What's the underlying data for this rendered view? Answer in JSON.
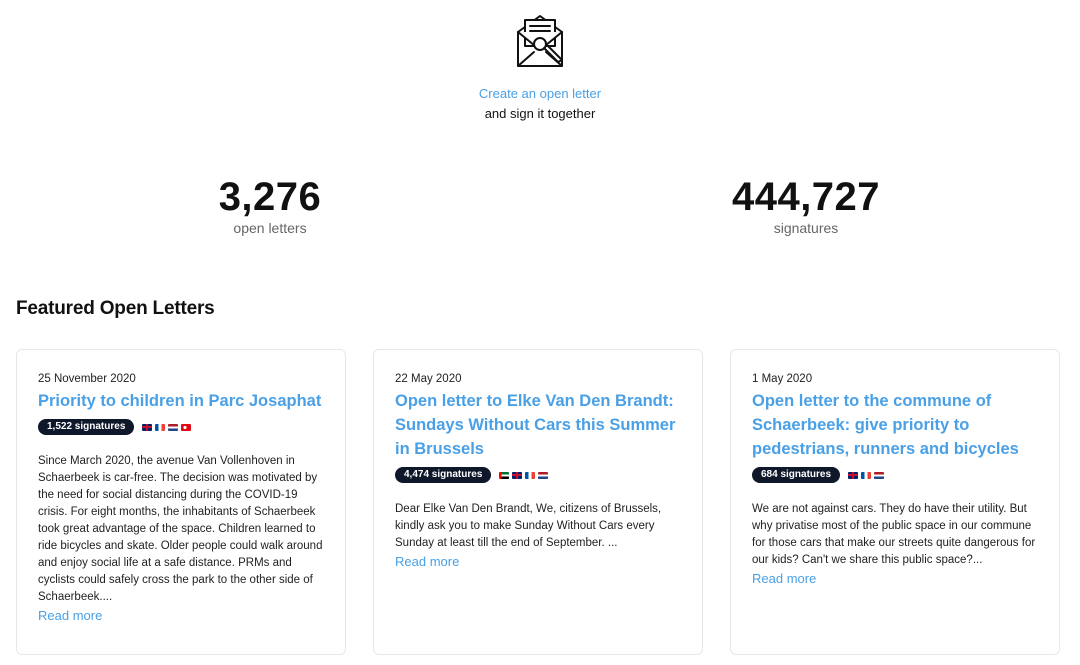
{
  "hero": {
    "icon": "envelope-letter-icon",
    "create_link": "Create an open letter",
    "subtitle": "and sign it together"
  },
  "stats": {
    "letters": {
      "value": "3,276",
      "label": "open letters"
    },
    "signatures": {
      "value": "444,727",
      "label": "signatures"
    }
  },
  "featured": {
    "heading": "Featured Open Letters",
    "cards": [
      {
        "date": "25 November 2020",
        "title": "Priority to children in Parc Josaphat",
        "signatures": "1,522 signatures",
        "languages": [
          "en",
          "fr",
          "nl",
          "tr"
        ],
        "excerpt": "Since March 2020, the avenue Van Vollenhoven in Schaerbeek is car-free. The decision was motivated by the need for social distancing during the COVID-19 crisis. For eight months, the inhabitants of Schaerbeek took great advantage of the space. Children learned to ride bicycles and skate. Older people could walk around and enjoy social life at a safe distance. PRMs and cyclists could safely cross the park to the other side of Schaerbeek....",
        "read_more": "Read more"
      },
      {
        "date": "22 May 2020",
        "title": "Open letter to Elke Van Den Brandt: Sundays Without Cars this Summer in Brussels",
        "signatures": "4,474 signatures",
        "languages": [
          "ar",
          "en",
          "fr",
          "nl"
        ],
        "excerpt": "Dear Elke Van Den Brandt, We, citizens of Brussels, kindly ask you to make Sunday Without Cars every Sunday at least till the end of September. ...",
        "read_more": "Read more"
      },
      {
        "date": "1 May 2020",
        "title": "Open letter to the commune of Schaerbeek: give priority to pedestrians, runners and bicycles",
        "signatures": "684 signatures",
        "languages": [
          "en",
          "fr",
          "nl"
        ],
        "excerpt": "We are not against cars. They do have their utility. But why privatise most of the public space in our commune for those cars that make our streets quite dangerous for our kids? Can't we share this public space?...",
        "read_more": "Read more"
      }
    ]
  },
  "colors": {
    "link": "#4aa0e6",
    "badge_bg": "#0f172a",
    "text": "#111111",
    "muted": "#666666",
    "card_border": "#e5e7eb"
  }
}
